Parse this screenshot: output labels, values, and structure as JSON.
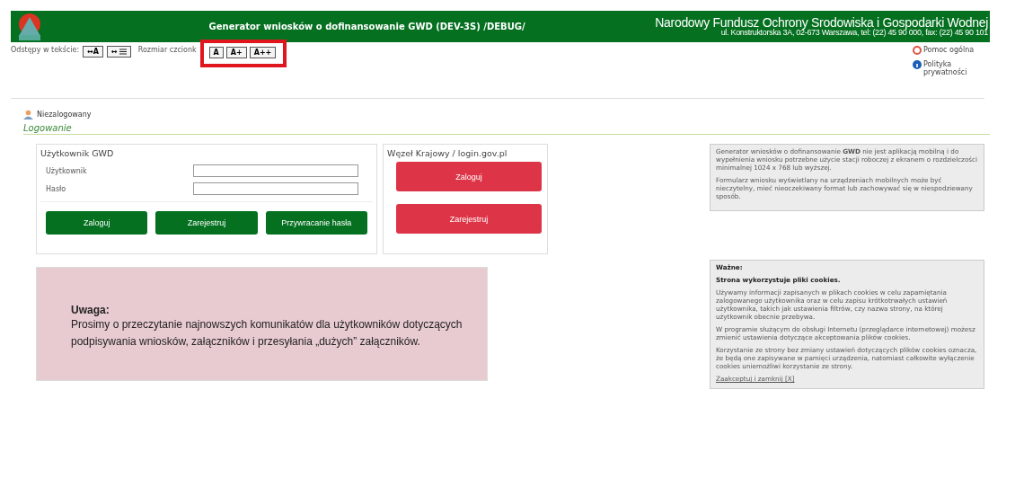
{
  "header": {
    "title": "Generator wniosków o dofinansowanie GWD (DEV-3S) /DEBUG/",
    "org_name": "Narodowy Fundusz Ochrony Srodowiska i Gospodarki Wodnej",
    "org_address": "ul. Konstruktorska 3A, 02-673 Warszawa, tel: (22) 45 90 000, fax: (22) 45 90 101"
  },
  "toolbar": {
    "spacing_label": "Odstępy w tekście:",
    "spacing_buttons": [
      {
        "label": "↔A",
        "kind": "letter"
      },
      {
        "label": "↔",
        "kind": "lines"
      }
    ],
    "font_label": "Rozmiar czcionk",
    "font_buttons": [
      "A",
      "A+",
      "A++"
    ],
    "highlighted": true
  },
  "links": [
    {
      "label": "Pomoc ogólna",
      "kind": "help"
    },
    {
      "label": "Polityka prywatności",
      "kind": "info"
    }
  ],
  "user_status": "Niezalogowany",
  "section_title": "Logowanie",
  "gwd_login": {
    "title": "Użytkownik GWD",
    "fields": [
      {
        "label": "Użytkownik"
      },
      {
        "label": "Hasło"
      }
    ],
    "buttons": [
      "Zaloguj",
      "Zarejestruj",
      "Przywracanie hasła"
    ]
  },
  "national_node": {
    "title": "Węzeł Krajowy / login.gov.pl",
    "buttons": [
      "Zaloguj",
      "Zarejestruj"
    ]
  },
  "notice": {
    "title": "Uwaga:",
    "text": "Prosimy o przeczytanie najnowszych komunikatów dla użytkowników dotyczących podpisywania wniosków, załączników i przesyłania „dużych” załączników."
  },
  "mobile_info": [
    "Generator wniosków o dofinansowanie **GWD** nie jest aplikacją mobilną i do wypełnienia wniosku potrzebne użycie stacji roboczej z ekranem o rozdzielczości minimalnej 1024 x 768 lub wyższej.",
    "Formularz wniosku wyświetlany na urządzeniach mobilnych może być nieczytelny, mieć nieoczekiwany format lub zachowywać się w niespodziewany sposób."
  ],
  "cookies": {
    "heading": "Ważne:",
    "title": "Strona wykorzystuje pliki cookies.",
    "paragraphs": [
      "Używamy informacji zapisanych w plikach cookies w celu zapamiętania zalogowanego użytkownika oraz w celu zapisu krótkotrwałych ustawień użytkownika, takich jak ustawienia filtrów, czy nazwa strony, na której użytkownik obecnie przebywa.",
      "W programie służącym do obsługi Internetu (przeglądarce internetowej) możesz zmienić ustawienia dotyczące akceptowania plików cookies.",
      "Korzystanie ze strony bez zmiany ustawień dotyczących plików cookies oznacza, że będą one zapisywane w pamięci urządzenia, natomiast całkowite wyłączenie cookies uniemożliwi korzystanie ze strony."
    ],
    "accept_link": "Zaakceptuj i zamknij [X]"
  }
}
